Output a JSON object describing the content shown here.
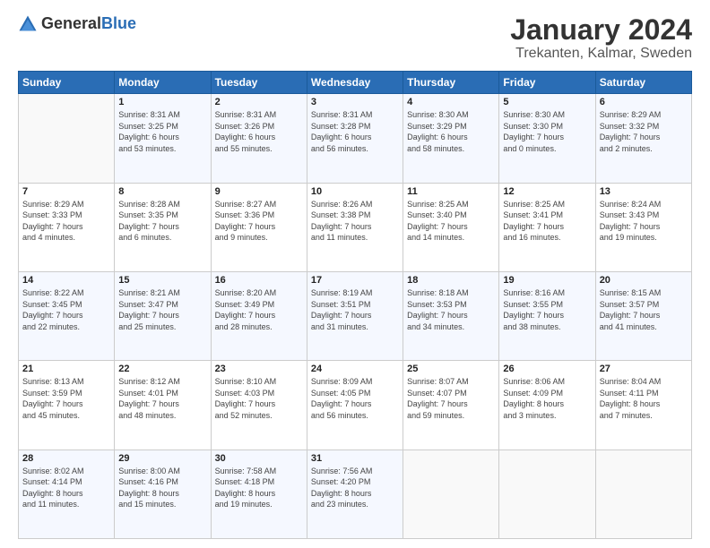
{
  "header": {
    "logo_general": "General",
    "logo_blue": "Blue",
    "month": "January 2024",
    "location": "Trekanten, Kalmar, Sweden"
  },
  "days_of_week": [
    "Sunday",
    "Monday",
    "Tuesday",
    "Wednesday",
    "Thursday",
    "Friday",
    "Saturday"
  ],
  "weeks": [
    [
      {
        "day": "",
        "info": ""
      },
      {
        "day": "1",
        "info": "Sunrise: 8:31 AM\nSunset: 3:25 PM\nDaylight: 6 hours\nand 53 minutes."
      },
      {
        "day": "2",
        "info": "Sunrise: 8:31 AM\nSunset: 3:26 PM\nDaylight: 6 hours\nand 55 minutes."
      },
      {
        "day": "3",
        "info": "Sunrise: 8:31 AM\nSunset: 3:28 PM\nDaylight: 6 hours\nand 56 minutes."
      },
      {
        "day": "4",
        "info": "Sunrise: 8:30 AM\nSunset: 3:29 PM\nDaylight: 6 hours\nand 58 minutes."
      },
      {
        "day": "5",
        "info": "Sunrise: 8:30 AM\nSunset: 3:30 PM\nDaylight: 7 hours\nand 0 minutes."
      },
      {
        "day": "6",
        "info": "Sunrise: 8:29 AM\nSunset: 3:32 PM\nDaylight: 7 hours\nand 2 minutes."
      }
    ],
    [
      {
        "day": "7",
        "info": "Sunrise: 8:29 AM\nSunset: 3:33 PM\nDaylight: 7 hours\nand 4 minutes."
      },
      {
        "day": "8",
        "info": "Sunrise: 8:28 AM\nSunset: 3:35 PM\nDaylight: 7 hours\nand 6 minutes."
      },
      {
        "day": "9",
        "info": "Sunrise: 8:27 AM\nSunset: 3:36 PM\nDaylight: 7 hours\nand 9 minutes."
      },
      {
        "day": "10",
        "info": "Sunrise: 8:26 AM\nSunset: 3:38 PM\nDaylight: 7 hours\nand 11 minutes."
      },
      {
        "day": "11",
        "info": "Sunrise: 8:25 AM\nSunset: 3:40 PM\nDaylight: 7 hours\nand 14 minutes."
      },
      {
        "day": "12",
        "info": "Sunrise: 8:25 AM\nSunset: 3:41 PM\nDaylight: 7 hours\nand 16 minutes."
      },
      {
        "day": "13",
        "info": "Sunrise: 8:24 AM\nSunset: 3:43 PM\nDaylight: 7 hours\nand 19 minutes."
      }
    ],
    [
      {
        "day": "14",
        "info": "Sunrise: 8:22 AM\nSunset: 3:45 PM\nDaylight: 7 hours\nand 22 minutes."
      },
      {
        "day": "15",
        "info": "Sunrise: 8:21 AM\nSunset: 3:47 PM\nDaylight: 7 hours\nand 25 minutes."
      },
      {
        "day": "16",
        "info": "Sunrise: 8:20 AM\nSunset: 3:49 PM\nDaylight: 7 hours\nand 28 minutes."
      },
      {
        "day": "17",
        "info": "Sunrise: 8:19 AM\nSunset: 3:51 PM\nDaylight: 7 hours\nand 31 minutes."
      },
      {
        "day": "18",
        "info": "Sunrise: 8:18 AM\nSunset: 3:53 PM\nDaylight: 7 hours\nand 34 minutes."
      },
      {
        "day": "19",
        "info": "Sunrise: 8:16 AM\nSunset: 3:55 PM\nDaylight: 7 hours\nand 38 minutes."
      },
      {
        "day": "20",
        "info": "Sunrise: 8:15 AM\nSunset: 3:57 PM\nDaylight: 7 hours\nand 41 minutes."
      }
    ],
    [
      {
        "day": "21",
        "info": "Sunrise: 8:13 AM\nSunset: 3:59 PM\nDaylight: 7 hours\nand 45 minutes."
      },
      {
        "day": "22",
        "info": "Sunrise: 8:12 AM\nSunset: 4:01 PM\nDaylight: 7 hours\nand 48 minutes."
      },
      {
        "day": "23",
        "info": "Sunrise: 8:10 AM\nSunset: 4:03 PM\nDaylight: 7 hours\nand 52 minutes."
      },
      {
        "day": "24",
        "info": "Sunrise: 8:09 AM\nSunset: 4:05 PM\nDaylight: 7 hours\nand 56 minutes."
      },
      {
        "day": "25",
        "info": "Sunrise: 8:07 AM\nSunset: 4:07 PM\nDaylight: 7 hours\nand 59 minutes."
      },
      {
        "day": "26",
        "info": "Sunrise: 8:06 AM\nSunset: 4:09 PM\nDaylight: 8 hours\nand 3 minutes."
      },
      {
        "day": "27",
        "info": "Sunrise: 8:04 AM\nSunset: 4:11 PM\nDaylight: 8 hours\nand 7 minutes."
      }
    ],
    [
      {
        "day": "28",
        "info": "Sunrise: 8:02 AM\nSunset: 4:14 PM\nDaylight: 8 hours\nand 11 minutes."
      },
      {
        "day": "29",
        "info": "Sunrise: 8:00 AM\nSunset: 4:16 PM\nDaylight: 8 hours\nand 15 minutes."
      },
      {
        "day": "30",
        "info": "Sunrise: 7:58 AM\nSunset: 4:18 PM\nDaylight: 8 hours\nand 19 minutes."
      },
      {
        "day": "31",
        "info": "Sunrise: 7:56 AM\nSunset: 4:20 PM\nDaylight: 8 hours\nand 23 minutes."
      },
      {
        "day": "",
        "info": ""
      },
      {
        "day": "",
        "info": ""
      },
      {
        "day": "",
        "info": ""
      }
    ]
  ]
}
